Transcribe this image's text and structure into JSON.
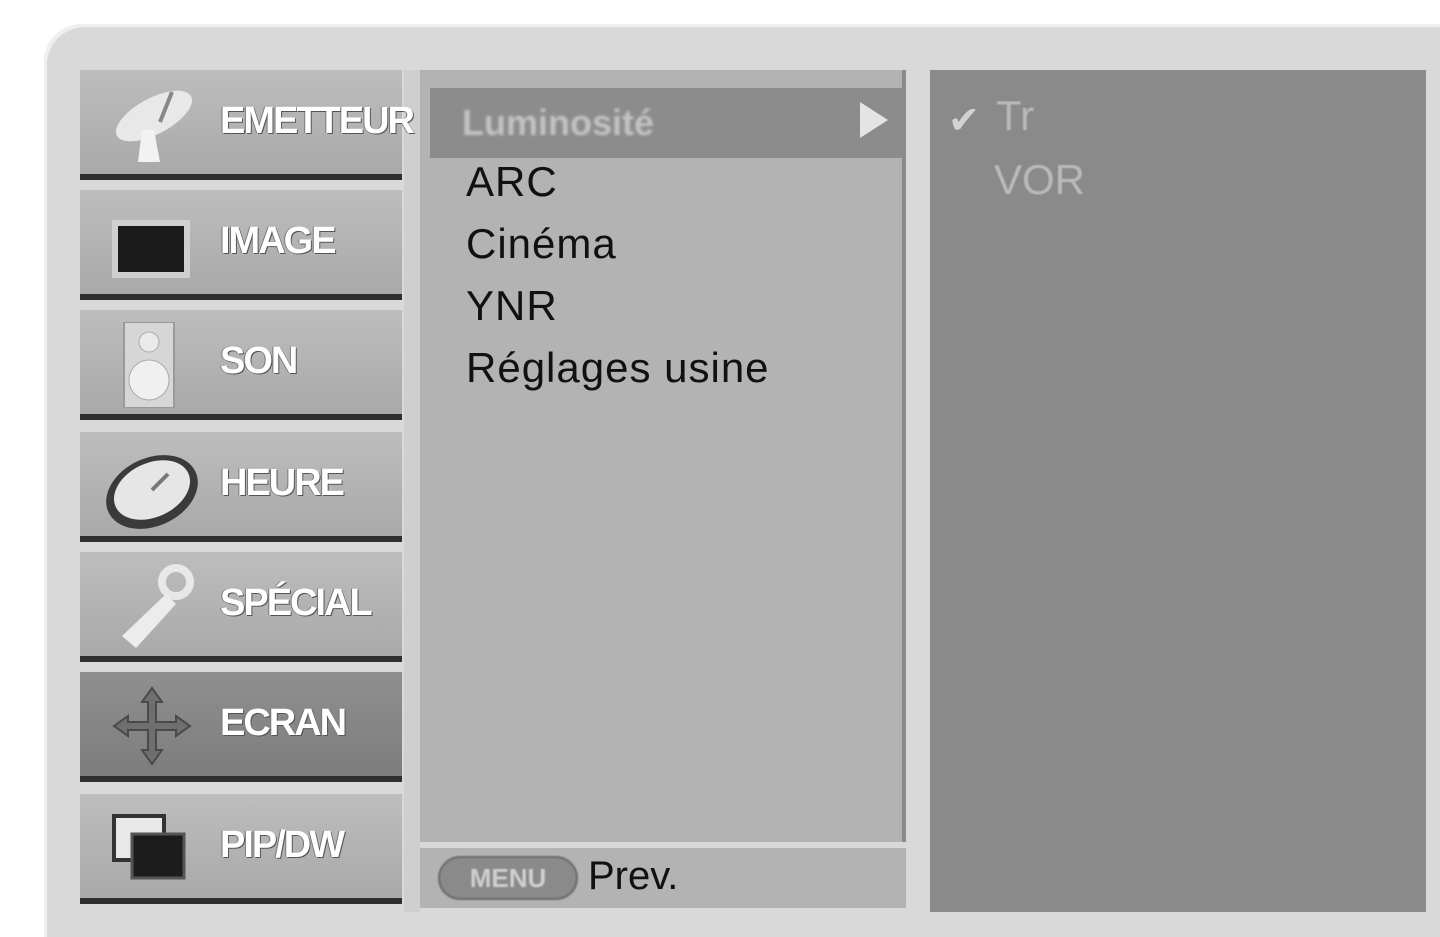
{
  "menu": {
    "categories": [
      {
        "label": "EMETTEUR",
        "icon": "satellite-dish-icon",
        "active": false
      },
      {
        "label": "IMAGE",
        "icon": "picture-icon",
        "active": false
      },
      {
        "label": "SON",
        "icon": "speaker-icon",
        "active": false
      },
      {
        "label": "HEURE",
        "icon": "clock-icon",
        "active": false
      },
      {
        "label": "SPÉCIAL",
        "icon": "key-icon",
        "active": false
      },
      {
        "label": "ECRAN",
        "icon": "move-arrows-icon",
        "active": true
      },
      {
        "label": "PIP/DW",
        "icon": "pip-windows-icon",
        "active": false
      }
    ]
  },
  "submenu": {
    "selected_label": "Luminosité",
    "items": [
      "ARC",
      "Cinéma",
      "YNR",
      "Réglages usine"
    ]
  },
  "options": {
    "items": [
      "Tr",
      "VOR"
    ],
    "checked_index": 0
  },
  "footer": {
    "menu_key": "MENU",
    "prev_label": "Prev."
  }
}
